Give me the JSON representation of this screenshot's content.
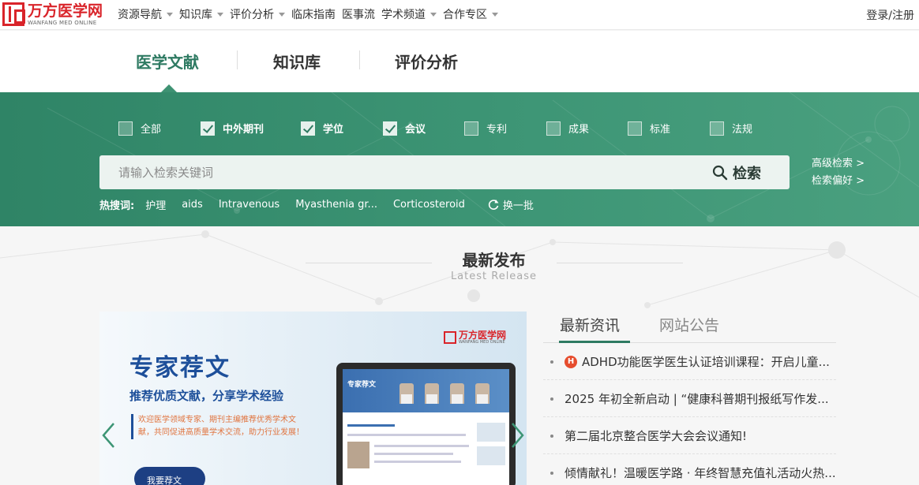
{
  "brand": {
    "name_cn": "万方医学网",
    "name_en": "WANFANG MED ONLINE",
    "color": "#d9242a"
  },
  "topnav": {
    "items": [
      {
        "label": "资源导航",
        "dropdown": true
      },
      {
        "label": "知识库",
        "dropdown": true
      },
      {
        "label": "评价分析",
        "dropdown": true
      },
      {
        "label": "临床指南",
        "dropdown": false
      },
      {
        "label": "医事流",
        "dropdown": false
      },
      {
        "label": "学术频道",
        "dropdown": true
      },
      {
        "label": "合作专区",
        "dropdown": true
      }
    ],
    "login": "登录/注册"
  },
  "tabs": [
    {
      "label": "医学文献",
      "active": true
    },
    {
      "label": "知识库",
      "active": false
    },
    {
      "label": "评价分析",
      "active": false
    }
  ],
  "filters": [
    {
      "label": "全部",
      "checked": false
    },
    {
      "label": "中外期刊",
      "checked": true
    },
    {
      "label": "学位",
      "checked": true
    },
    {
      "label": "会议",
      "checked": true
    },
    {
      "label": "专利",
      "checked": false
    },
    {
      "label": "成果",
      "checked": false
    },
    {
      "label": "标准",
      "checked": false
    },
    {
      "label": "法规",
      "checked": false
    }
  ],
  "search": {
    "placeholder": "请输入检索关键词",
    "button": "检索",
    "advanced": "高级检索 >",
    "preferences": "检索偏好 >"
  },
  "hot": {
    "label": "热搜词:",
    "keywords": [
      "护理",
      "aids",
      "Intravenous",
      "Myasthenia gr...",
      "Corticosteroid"
    ],
    "refresh": "换一批"
  },
  "section": {
    "title": "最新发布",
    "subtitle": "Latest Release"
  },
  "banner": {
    "title": "专家荐文",
    "subtitle": "推荐优质文献，分享学术经验",
    "body": "欢迎医学领域专家、期刊主编推荐优秀学术文献，共同促进高质量学术交流，助力行业发展！",
    "button": "我要荐文",
    "logo_cn": "万方医学网",
    "logo_en": "WANFANG MED ONLINE",
    "screen_title": "专家荐文"
  },
  "news": {
    "tabs": [
      {
        "label": "最新资讯",
        "active": true
      },
      {
        "label": "网站公告",
        "active": false
      }
    ],
    "items": [
      {
        "title": "ADHD功能医学医生认证培训课程：开启儿童...",
        "hot": true
      },
      {
        "title": "2025 年初全新启动 | “健康科普期刊报纸写作发...",
        "hot": false
      },
      {
        "title": "第二届北京整合医学大会会议通知!",
        "hot": false
      },
      {
        "title": "倾情献礼！温暖医学路 · 年终智慧充值礼活动火热...",
        "hot": false
      }
    ]
  },
  "colors": {
    "accent": "#2e7a62",
    "band": "#3d9575"
  }
}
